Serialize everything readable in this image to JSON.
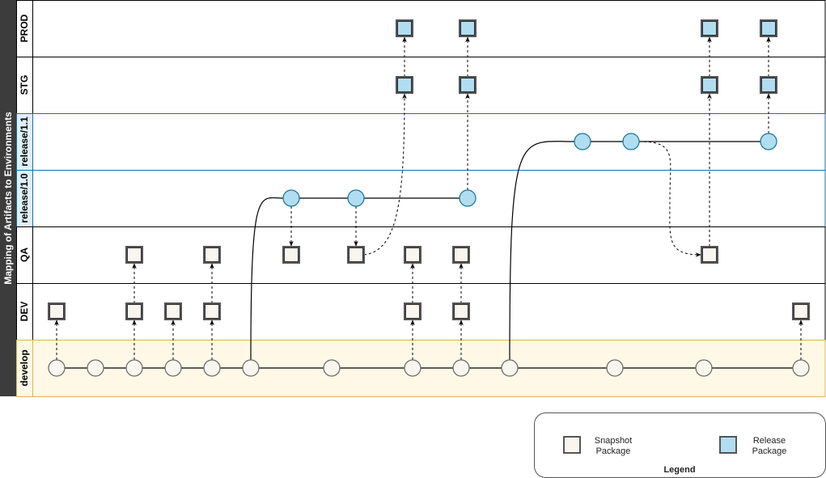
{
  "title": "Mapping of Artifacts to Environments",
  "colors": {
    "title_bar": "#3c3c3c",
    "snapshot_fill": "#f8f6ef",
    "release_fill": "#b1ddf0",
    "release_stroke": "#10739e",
    "develop_fill": "#fff8e6",
    "develop_stroke": "#d6b656",
    "release_lane_fill": "#dff0f8",
    "release_lane_stroke": "#10739e",
    "package_stroke": "#555555"
  },
  "lanes": [
    {
      "id": "prod",
      "label": "PROD",
      "kind": "env"
    },
    {
      "id": "stg",
      "label": "STG",
      "kind": "env"
    },
    {
      "id": "rel11",
      "label": "release/1.1",
      "kind": "branch"
    },
    {
      "id": "rel10",
      "label": "release/1.0",
      "kind": "branch"
    },
    {
      "id": "qa",
      "label": "QA",
      "kind": "env"
    },
    {
      "id": "dev",
      "label": "DEV",
      "kind": "env"
    },
    {
      "id": "develop",
      "label": "develop",
      "kind": "develop"
    }
  ],
  "commits": [
    {
      "id": "d1",
      "lane": "develop",
      "col": 70,
      "type": "snapshot"
    },
    {
      "id": "d2",
      "lane": "develop",
      "col": 118,
      "type": "snapshot"
    },
    {
      "id": "d3",
      "lane": "develop",
      "col": 166,
      "type": "snapshot"
    },
    {
      "id": "d4",
      "lane": "develop",
      "col": 214,
      "type": "snapshot"
    },
    {
      "id": "d5",
      "lane": "develop",
      "col": 262,
      "type": "snapshot"
    },
    {
      "id": "d6",
      "lane": "develop",
      "col": 310,
      "type": "snapshot"
    },
    {
      "id": "d7",
      "lane": "develop",
      "col": 410,
      "type": "snapshot"
    },
    {
      "id": "d8",
      "lane": "develop",
      "col": 510,
      "type": "snapshot"
    },
    {
      "id": "d9",
      "lane": "develop",
      "col": 570,
      "type": "snapshot"
    },
    {
      "id": "d10",
      "lane": "develop",
      "col": 630,
      "type": "snapshot"
    },
    {
      "id": "d11",
      "lane": "develop",
      "col": 760,
      "type": "snapshot"
    },
    {
      "id": "d12",
      "lane": "develop",
      "col": 870,
      "type": "snapshot"
    },
    {
      "id": "d13",
      "lane": "develop",
      "col": 990,
      "type": "snapshot"
    },
    {
      "id": "r10a",
      "lane": "rel10",
      "col": 360,
      "type": "release"
    },
    {
      "id": "r10b",
      "lane": "rel10",
      "col": 440,
      "type": "release"
    },
    {
      "id": "r10c",
      "lane": "rel10",
      "col": 578,
      "type": "release"
    },
    {
      "id": "r11a",
      "lane": "rel11",
      "col": 720,
      "type": "release"
    },
    {
      "id": "r11b",
      "lane": "rel11",
      "col": 780,
      "type": "release"
    },
    {
      "id": "r11c",
      "lane": "rel11",
      "col": 950,
      "type": "release"
    }
  ],
  "branch_lines": [
    {
      "from": "d1",
      "to": "d13"
    },
    {
      "from": "r10a",
      "to": "r10c"
    },
    {
      "from": "r11a",
      "to": "r11c"
    }
  ],
  "branch_curves": [
    {
      "from": "d6",
      "to": "r10a"
    },
    {
      "from": "d10",
      "to": "r11a"
    }
  ],
  "packages": [
    {
      "id": "p-dev-1",
      "lane": "dev",
      "col": 70,
      "type": "snapshot"
    },
    {
      "id": "p-dev-2",
      "lane": "dev",
      "col": 166,
      "type": "snapshot"
    },
    {
      "id": "p-dev-3",
      "lane": "dev",
      "col": 214,
      "type": "snapshot"
    },
    {
      "id": "p-dev-4",
      "lane": "dev",
      "col": 262,
      "type": "snapshot"
    },
    {
      "id": "p-dev-5",
      "lane": "dev",
      "col": 510,
      "type": "snapshot"
    },
    {
      "id": "p-dev-6",
      "lane": "dev",
      "col": 570,
      "type": "snapshot"
    },
    {
      "id": "p-dev-7",
      "lane": "dev",
      "col": 990,
      "type": "snapshot"
    },
    {
      "id": "p-qa-1",
      "lane": "qa",
      "col": 166,
      "type": "snapshot"
    },
    {
      "id": "p-qa-2",
      "lane": "qa",
      "col": 262,
      "type": "snapshot"
    },
    {
      "id": "p-qa-3",
      "lane": "qa",
      "col": 360,
      "type": "snapshot"
    },
    {
      "id": "p-qa-4",
      "lane": "qa",
      "col": 440,
      "type": "snapshot"
    },
    {
      "id": "p-qa-5",
      "lane": "qa",
      "col": 510,
      "type": "snapshot"
    },
    {
      "id": "p-qa-6",
      "lane": "qa",
      "col": 570,
      "type": "snapshot"
    },
    {
      "id": "p-qa-7",
      "lane": "qa",
      "col": 877,
      "type": "snapshot"
    },
    {
      "id": "p-stg-1",
      "lane": "stg",
      "col": 500,
      "type": "release"
    },
    {
      "id": "p-stg-2",
      "lane": "stg",
      "col": 578,
      "type": "release"
    },
    {
      "id": "p-stg-3",
      "lane": "stg",
      "col": 877,
      "type": "release"
    },
    {
      "id": "p-stg-4",
      "lane": "stg",
      "col": 950,
      "type": "release"
    },
    {
      "id": "p-prod-1",
      "lane": "prod",
      "col": 500,
      "type": "release"
    },
    {
      "id": "p-prod-2",
      "lane": "prod",
      "col": 578,
      "type": "release"
    },
    {
      "id": "p-prod-3",
      "lane": "prod",
      "col": 877,
      "type": "release"
    },
    {
      "id": "p-prod-4",
      "lane": "prod",
      "col": 950,
      "type": "release"
    }
  ],
  "promotions": [
    {
      "from": "d1",
      "to": "p-dev-1"
    },
    {
      "from": "d3",
      "to": "p-dev-2"
    },
    {
      "from": "d4",
      "to": "p-dev-3"
    },
    {
      "from": "d5",
      "to": "p-dev-4"
    },
    {
      "from": "d8",
      "to": "p-dev-5"
    },
    {
      "from": "d9",
      "to": "p-dev-6"
    },
    {
      "from": "d13",
      "to": "p-dev-7"
    },
    {
      "from": "p-dev-2",
      "to": "p-qa-1"
    },
    {
      "from": "p-dev-4",
      "to": "p-qa-2"
    },
    {
      "from": "p-dev-5",
      "to": "p-qa-5"
    },
    {
      "from": "p-dev-6",
      "to": "p-qa-6"
    },
    {
      "from": "r10a",
      "to": "p-qa-3"
    },
    {
      "from": "r10b",
      "to": "p-qa-4"
    },
    {
      "from": "p-qa-4",
      "to": "p-stg-1",
      "curve": true
    },
    {
      "from": "r10c",
      "to": "p-stg-2"
    },
    {
      "from": "p-stg-1",
      "to": "p-prod-1"
    },
    {
      "from": "p-stg-2",
      "to": "p-prod-2"
    },
    {
      "from": "r11b",
      "to": "p-qa-7",
      "curve": true
    },
    {
      "from": "p-qa-7",
      "to": "p-stg-3"
    },
    {
      "from": "p-stg-3",
      "to": "p-prod-3"
    },
    {
      "from": "r11c",
      "to": "p-stg-4"
    },
    {
      "from": "p-stg-4",
      "to": "p-prod-4"
    }
  ],
  "legend": {
    "title": "Legend",
    "snapshot_line1": "Snapshot",
    "snapshot_line2": "Package",
    "release_line1": "Release",
    "release_line2": "Package"
  }
}
